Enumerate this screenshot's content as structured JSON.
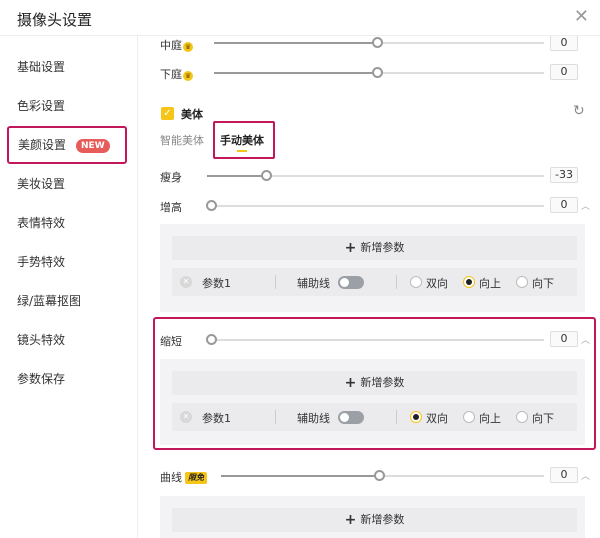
{
  "window": {
    "title": "摄像头设置",
    "close_icon": "close-icon"
  },
  "sidebar": {
    "items": [
      {
        "label": "基础设置"
      },
      {
        "label": "色彩设置"
      },
      {
        "label": "美颜设置",
        "badge": "NEW",
        "active": true
      },
      {
        "label": "美妆设置"
      },
      {
        "label": "表情特效"
      },
      {
        "label": "手势特效"
      },
      {
        "label": "绿/蓝幕抠图"
      },
      {
        "label": "镜头特效"
      },
      {
        "label": "参数保存"
      }
    ]
  },
  "sliders_top": [
    {
      "label": "中庭",
      "value": "0",
      "level": 0.5
    },
    {
      "label": "下庭",
      "value": "0",
      "level": 0.5
    }
  ],
  "body_section": {
    "title": "美体",
    "checked": true,
    "tabs": [
      {
        "label": "智能美体",
        "active": false
      },
      {
        "label": "手动美体",
        "active": true
      }
    ],
    "sliders": [
      {
        "label": "瘦身",
        "value": "-33",
        "level": 0.17
      },
      {
        "label": "增高",
        "value": "0",
        "level": 0.0
      }
    ]
  },
  "add_param_label": "新增参数",
  "param_row": {
    "name": "参数1",
    "aux_label": "辅助线",
    "options": [
      "双向",
      "向上",
      "向下"
    ]
  },
  "panel1_selected": "向上",
  "shorten": {
    "label": "缩短",
    "value": "0",
    "level": 0.0
  },
  "panel2_selected": "双向",
  "curve": {
    "label": "曲线",
    "tag": "限免",
    "value": "0",
    "level": 0.5
  },
  "colors": {
    "accent": "#f5c518",
    "highlight": "#c2185b",
    "badge": "#e85b5b"
  }
}
